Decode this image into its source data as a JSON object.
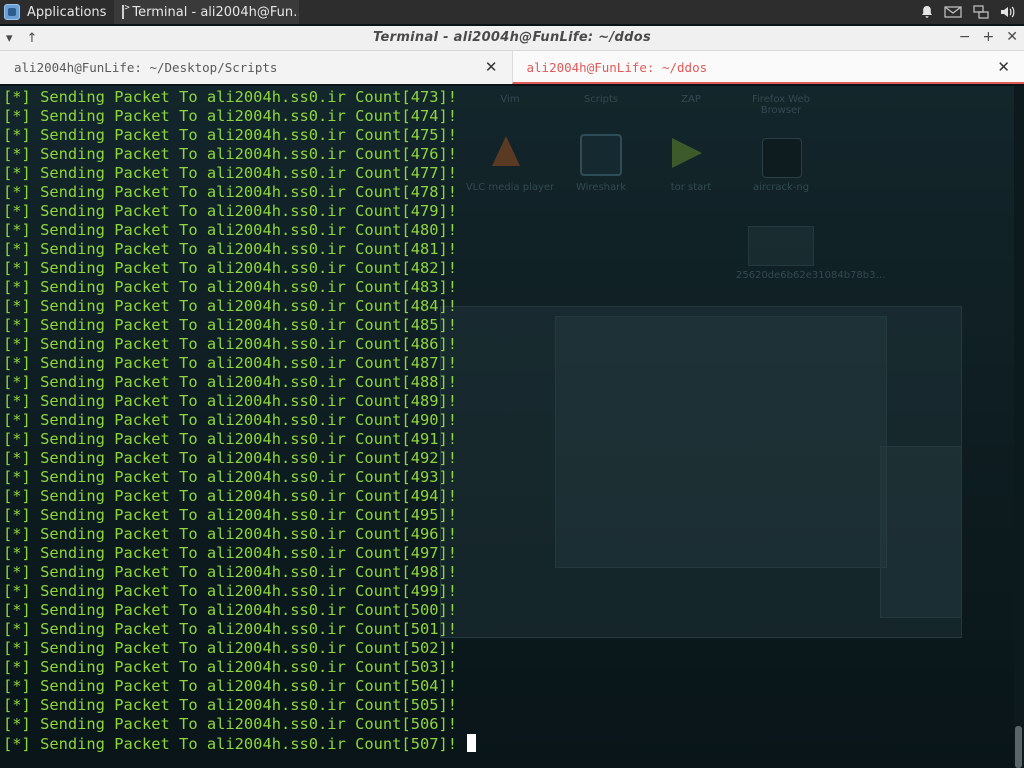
{
  "panel": {
    "applications_label": "Applications",
    "task_label": "Terminal - ali2004h@Fun…",
    "tray_icons": [
      "bell-icon",
      "mail-icon",
      "network-icon",
      "volume-icon"
    ]
  },
  "window": {
    "title": "Terminal - ali2004h@FunLife: ~/ddos",
    "left_controls": [
      "▾",
      "↑"
    ],
    "right_controls": [
      "−",
      "+",
      "✕"
    ]
  },
  "tabs": [
    {
      "label": "ali2004h@FunLife: ~/Desktop/Scripts",
      "close": "✕",
      "active": false
    },
    {
      "label": "ali2004h@FunLife: ~/ddos",
      "close": "✕",
      "active": true
    }
  ],
  "desktop": {
    "labels": [
      "Vim",
      "Scripts",
      "ZAP",
      "Firefox Web Browser",
      "VLC media player",
      "Wireshark",
      "tor start",
      "aircrack-ng",
      "25620de6b62e31084b78b3…"
    ]
  },
  "terminal": {
    "text_color": "#8ed63b",
    "lines": [
      "[*] Sending Packet To ali2004h.ss0.ir Count[473]!",
      "[*] Sending Packet To ali2004h.ss0.ir Count[474]!",
      "[*] Sending Packet To ali2004h.ss0.ir Count[475]!",
      "[*] Sending Packet To ali2004h.ss0.ir Count[476]!",
      "[*] Sending Packet To ali2004h.ss0.ir Count[477]!",
      "[*] Sending Packet To ali2004h.ss0.ir Count[478]!",
      "[*] Sending Packet To ali2004h.ss0.ir Count[479]!",
      "[*] Sending Packet To ali2004h.ss0.ir Count[480]!",
      "[*] Sending Packet To ali2004h.ss0.ir Count[481]!",
      "[*] Sending Packet To ali2004h.ss0.ir Count[482]!",
      "[*] Sending Packet To ali2004h.ss0.ir Count[483]!",
      "[*] Sending Packet To ali2004h.ss0.ir Count[484]!",
      "[*] Sending Packet To ali2004h.ss0.ir Count[485]!",
      "[*] Sending Packet To ali2004h.ss0.ir Count[486]!",
      "[*] Sending Packet To ali2004h.ss0.ir Count[487]!",
      "[*] Sending Packet To ali2004h.ss0.ir Count[488]!",
      "[*] Sending Packet To ali2004h.ss0.ir Count[489]!",
      "[*] Sending Packet To ali2004h.ss0.ir Count[490]!",
      "[*] Sending Packet To ali2004h.ss0.ir Count[491]!",
      "[*] Sending Packet To ali2004h.ss0.ir Count[492]!",
      "[*] Sending Packet To ali2004h.ss0.ir Count[493]!",
      "[*] Sending Packet To ali2004h.ss0.ir Count[494]!",
      "[*] Sending Packet To ali2004h.ss0.ir Count[495]!",
      "[*] Sending Packet To ali2004h.ss0.ir Count[496]!",
      "[*] Sending Packet To ali2004h.ss0.ir Count[497]!",
      "[*] Sending Packet To ali2004h.ss0.ir Count[498]!",
      "[*] Sending Packet To ali2004h.ss0.ir Count[499]!",
      "[*] Sending Packet To ali2004h.ss0.ir Count[500]!",
      "[*] Sending Packet To ali2004h.ss0.ir Count[501]!",
      "[*] Sending Packet To ali2004h.ss0.ir Count[502]!",
      "[*] Sending Packet To ali2004h.ss0.ir Count[503]!",
      "[*] Sending Packet To ali2004h.ss0.ir Count[504]!",
      "[*] Sending Packet To ali2004h.ss0.ir Count[505]!",
      "[*] Sending Packet To ali2004h.ss0.ir Count[506]!",
      "[*] Sending Packet To ali2004h.ss0.ir Count[507]!"
    ]
  }
}
